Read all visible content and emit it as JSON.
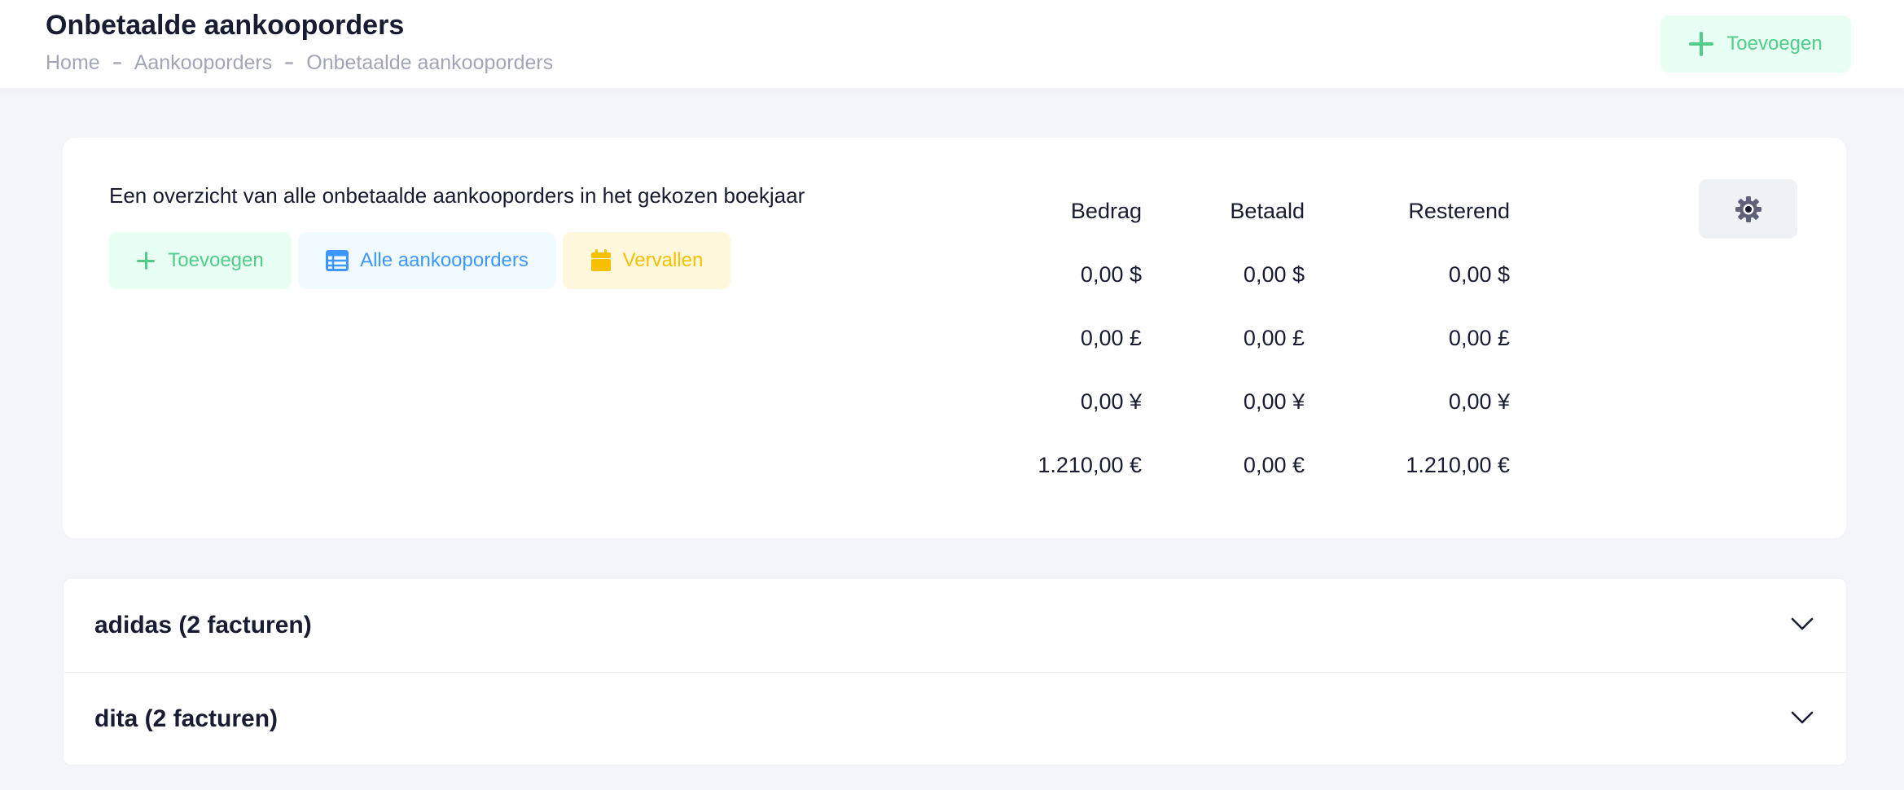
{
  "header": {
    "title": "Onbetaalde aankooporders",
    "breadcrumb": [
      "Home",
      "Aankooporders",
      "Onbetaalde aankooporders"
    ],
    "add_button": "Toevoegen"
  },
  "summary": {
    "description": "Een overzicht van alle onbetaalde aankooporders in het gekozen boekjaar",
    "buttons": {
      "add": "Toevoegen",
      "all": "Alle aankooporders",
      "expired": "Vervallen"
    },
    "columns": [
      "Bedrag",
      "Betaald",
      "Resterend"
    ],
    "rows": [
      [
        "0,00 $",
        "0,00 $",
        "0,00 $"
      ],
      [
        "0,00 £",
        "0,00 £",
        "0,00 £"
      ],
      [
        "0,00 ¥",
        "0,00 ¥",
        "0,00 ¥"
      ],
      [
        "1.210,00 €",
        "0,00 €",
        "1.210,00 €"
      ]
    ]
  },
  "groups": [
    {
      "label": "adidas (2 facturen)"
    },
    {
      "label": "dita (2 facturen)"
    }
  ],
  "icons": {
    "add": "plus-icon",
    "all": "table-list-icon",
    "expired": "calendar-icon",
    "settings": "gear-icon",
    "expand": "chevron-down-icon"
  },
  "colors": {
    "success": "#50cd89",
    "success_light": "#e8fff3",
    "primary": "#3e97ff",
    "primary_light": "#f1faff",
    "warning": "#f6c000",
    "warning_light": "#fff8dd",
    "text": "#181c32",
    "muted": "#a1a5b7"
  }
}
